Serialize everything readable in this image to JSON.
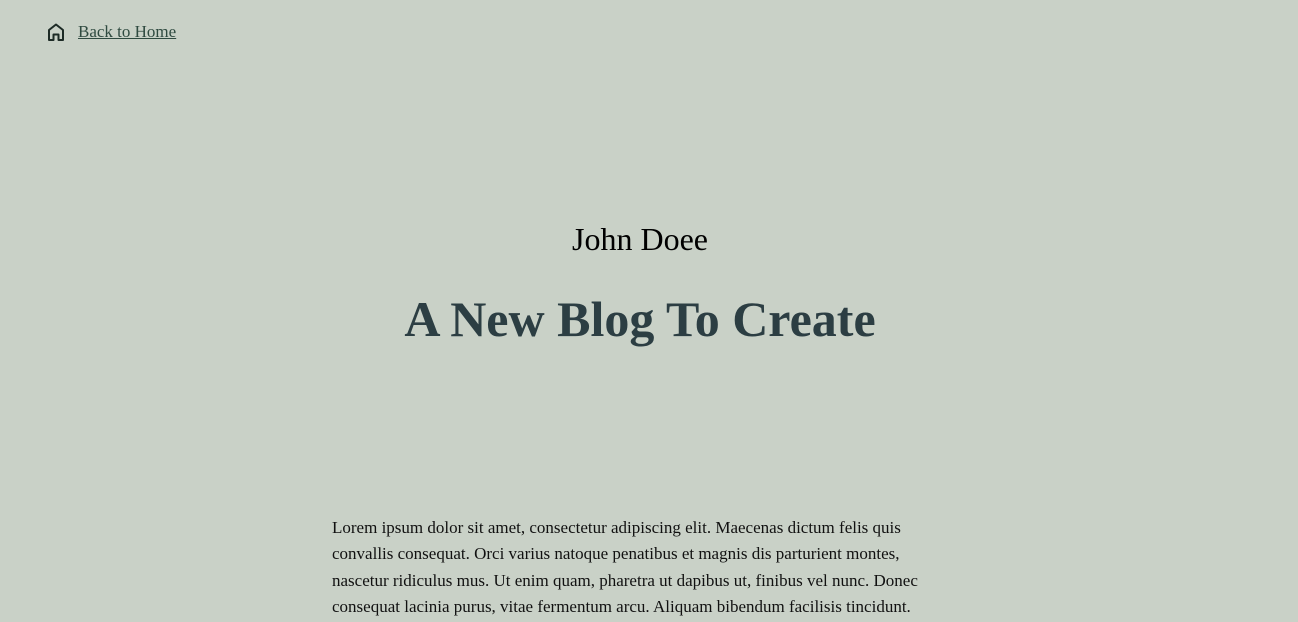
{
  "nav": {
    "back_label": "Back to Home",
    "back_icon": "home-icon"
  },
  "post": {
    "author": "John Doee",
    "title": "A New Blog To Create",
    "body": "Lorem ipsum dolor sit amet, consectetur adipiscing elit. Maecenas dictum felis quis convallis consequat. Orci varius natoque penatibus et magnis dis parturient montes, nascetur ridiculus mus. Ut enim quam, pharetra ut dapibus ut, finibus vel nunc. Donec consequat lacinia purus, vitae fermentum arcu. Aliquam bibendum facilisis tincidunt."
  },
  "colors": {
    "background": "#c9d1c7",
    "title": "#2c3e43",
    "link": "#2f4a40"
  }
}
